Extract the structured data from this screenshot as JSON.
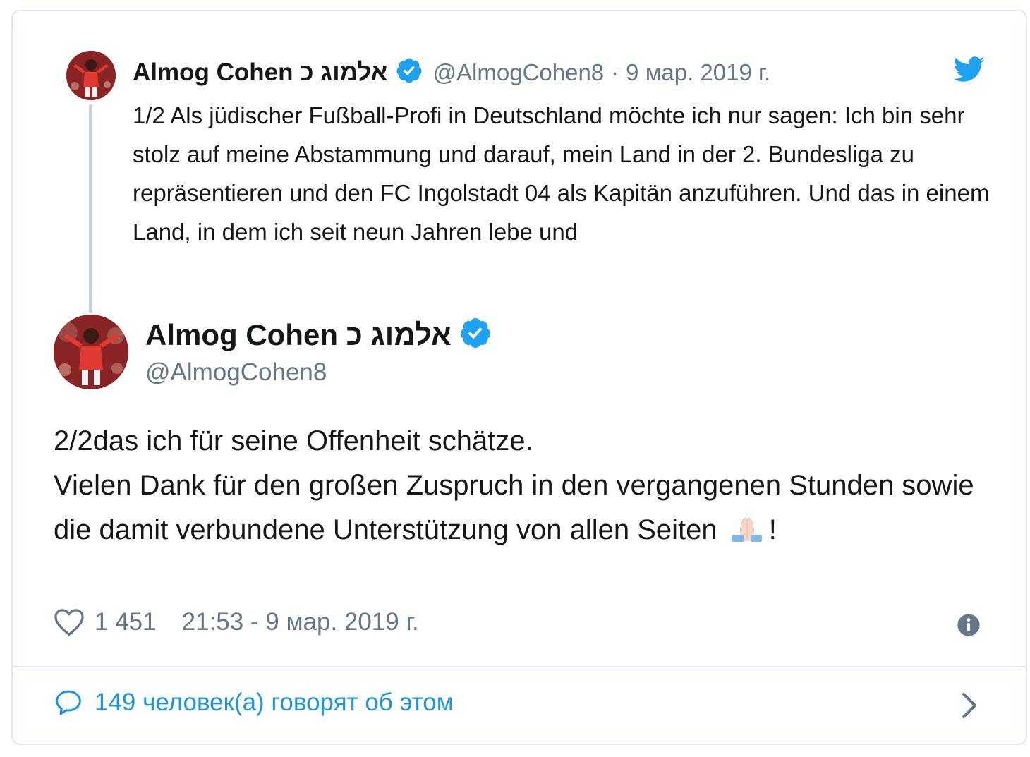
{
  "parent_tweet": {
    "avatar": "player-avatar",
    "name": "Almog Cohen אלמוג כ",
    "handle": "@AlmogCohen8",
    "separator": "·",
    "date": "9 мар. 2019 г.",
    "text": "1/2 Als jüdischer Fußball-Profi in Deutschland möchte ich nur sagen: Ich bin sehr stolz auf meine Abstammung und darauf, mein Land in der 2. Bundesliga zu repräsentieren und den FC Ingolstadt 04 als Kapitän anzuführen. Und das in einem Land, in dem ich seit neun Jahren lebe und",
    "brand_icon": "twitter-bird-icon"
  },
  "main_tweet": {
    "avatar": "player-avatar",
    "name": "Almog Cohen אלמוג כ",
    "handle": "@AlmogCohen8",
    "text_line1": "2/2das ich für seine Offenheit schätze.",
    "text_line2": "Vielen Dank für den großen Zuspruch in den vergangenen Stunden sowie die damit verbundene Unterstützung von allen Seiten ",
    "emoji": "folded-hands-emoji",
    "text_end": "!",
    "likes": "1 451",
    "timestamp": "21:53 - 9 мар. 2019 г."
  },
  "footer": {
    "conversation_label": "149 человек(а) говорят об этом"
  },
  "colors": {
    "accent": "#1da1f2",
    "link": "#1b95e0",
    "muted": "#657786",
    "text": "#14171a",
    "border": "#e1e8ed"
  }
}
